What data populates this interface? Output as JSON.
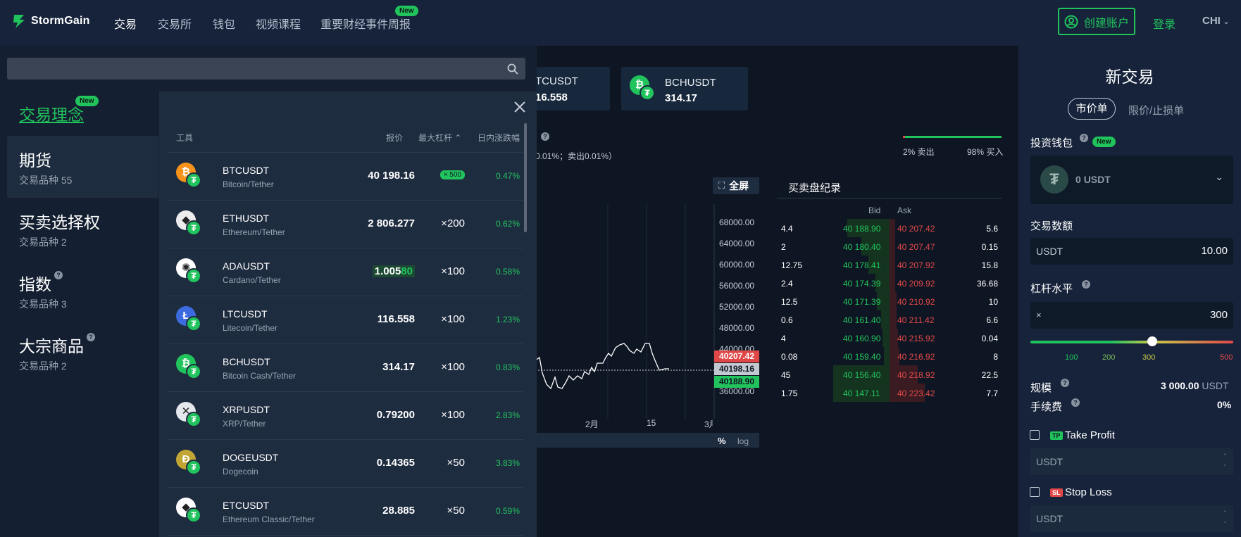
{
  "header": {
    "logo_text": "StormGain",
    "nav": [
      "交易",
      "交易所",
      "钱包",
      "视频课程",
      "重要财经事件周报"
    ],
    "nav_new_badge": "New",
    "create_account": "创建账户",
    "login": "登录",
    "language": "CHI"
  },
  "background": {
    "tiles": [
      {
        "symbol": "TCUSDT",
        "price": "16.558"
      },
      {
        "symbol": "BCHUSDT",
        "price": "314.17"
      }
    ],
    "fee_note": "0.01%；卖出0.01%）",
    "sentiment": {
      "sell": "2% 卖出",
      "buy": "98% 买入",
      "sell_pct": 2
    },
    "fullscreen": "全屏",
    "chart": {
      "y_ticks": [
        "68000.00",
        "64000.00",
        "60000.00",
        "56000.00",
        "52000.00",
        "48000.00",
        "44000.00",
        "40000.00",
        "36000.00"
      ],
      "x_ticks": [
        "2月",
        "15",
        "3月"
      ],
      "ask_label": "40207.42",
      "last_label": "40198.16",
      "bid_label": "40188.90",
      "scale_pct": "%",
      "scale_log": "log"
    },
    "orderbook": {
      "title": "买卖盘纪录",
      "bid_header": "Bid",
      "ask_header": "Ask",
      "rows": [
        {
          "bsize": "4.4",
          "bid": "40 188.90",
          "ask": "40 207.42",
          "asize": "5.6"
        },
        {
          "bsize": "2",
          "bid": "40 180.40",
          "ask": "40 207.47",
          "asize": "0.15"
        },
        {
          "bsize": "12.75",
          "bid": "40 178.41",
          "ask": "40 207.92",
          "asize": "15.8"
        },
        {
          "bsize": "2.4",
          "bid": "40 174.39",
          "ask": "40 209.92",
          "asize": "36.68"
        },
        {
          "bsize": "12.5",
          "bid": "40 171.39",
          "ask": "40 210.92",
          "asize": "10"
        },
        {
          "bsize": "0.6",
          "bid": "40 161.40",
          "ask": "40 211.42",
          "asize": "6.6"
        },
        {
          "bsize": "4",
          "bid": "40 160.90",
          "ask": "40 215.92",
          "asize": "0.04"
        },
        {
          "bsize": "0.08",
          "bid": "40 159.40",
          "ask": "40 216.92",
          "asize": "8"
        },
        {
          "bsize": "45",
          "bid": "40 156.40",
          "ask": "40 218.92",
          "asize": "22.5"
        },
        {
          "bsize": "1.75",
          "bid": "40 147.11",
          "ask": "40 223.42",
          "asize": "7.7"
        }
      ]
    }
  },
  "trade_panel": {
    "title": "新交易",
    "tab_market": "市价单",
    "tab_limit": "限价/止损单",
    "wallet_label": "投资钱包",
    "wallet_new": "New",
    "wallet_value": "0",
    "wallet_currency": "USDT",
    "amount_label": "交易数额",
    "amount_currency": "USDT",
    "amount_value": "10.00",
    "leverage_label": "杠杆水平",
    "leverage_prefix": "×",
    "leverage_value": "300",
    "leverage_marks": [
      "100",
      "200",
      "300",
      "500"
    ],
    "leverage_fraction": 0.6,
    "size_label": "规模",
    "size_value": "3 000.00",
    "size_currency": "USDT",
    "fee_label": "手续费",
    "fee_value": "0%",
    "tp_badge": "TP",
    "tp_label": "Take Profit",
    "tp_placeholder": "USDT",
    "sl_badge": "SL",
    "sl_label": "Stop Loss",
    "sl_placeholder": "USDT"
  },
  "overlay": {
    "categories": [
      {
        "title": "交易理念",
        "sub": "",
        "badge": "New"
      },
      {
        "title": "期货",
        "sub": "交易品种 55"
      },
      {
        "title": "买卖选择权",
        "sub": "交易品种 2"
      },
      {
        "title": "指数",
        "sub": "交易品种 3"
      },
      {
        "title": "大宗商品",
        "sub": "交易品种 2"
      }
    ],
    "list_headers": {
      "instrument": "工具",
      "price": "报价",
      "leverage": "最大杠杆",
      "change": "日内涨跌幅"
    },
    "instruments": [
      {
        "symbol": "BTCUSDT",
        "name": "Bitcoin/Tether",
        "price": "40 198.16",
        "leverage": "× 500",
        "change": "0.47%",
        "color": "#f7931a",
        "glyph": "₿"
      },
      {
        "symbol": "ETHUSDT",
        "name": "Ethereum/Tether",
        "price": "2 806.277",
        "leverage": "×200",
        "change": "0.62%",
        "color": "#ececec",
        "glyph": "◆"
      },
      {
        "symbol": "ADAUSDT",
        "name": "Cardano/Tether",
        "price_a": "1.005",
        "price_b": "80",
        "leverage": "×100",
        "change": "0.58%",
        "color": "#ffffff",
        "glyph": "✺"
      },
      {
        "symbol": "LTCUSDT",
        "name": "Litecoin/Tether",
        "price": "116.558",
        "leverage": "×100",
        "change": "1.23%",
        "color": "#3c6be0",
        "glyph": "Ł"
      },
      {
        "symbol": "BCHUSDT",
        "name": "Bitcoin Cash/Tether",
        "price": "314.17",
        "leverage": "×100",
        "change": "0.83%",
        "color": "#21c35c",
        "glyph": "₿"
      },
      {
        "symbol": "XRPUSDT",
        "name": "XRP/Tether",
        "price": "0.79200",
        "leverage": "×100",
        "change": "2.83%",
        "color": "#e4e7eb",
        "glyph": "✕"
      },
      {
        "symbol": "DOGEUSDT",
        "name": "Dogecoin",
        "price": "0.14365",
        "leverage": "×50",
        "change": "3.83%",
        "color": "#c2a633",
        "glyph": "Ð"
      },
      {
        "symbol": "ETCUSDT",
        "name": "Ethereum Classic/Tether",
        "price": "28.885",
        "leverage": "×50",
        "change": "0.59%",
        "color": "#ffffff",
        "glyph": "◆"
      }
    ]
  }
}
